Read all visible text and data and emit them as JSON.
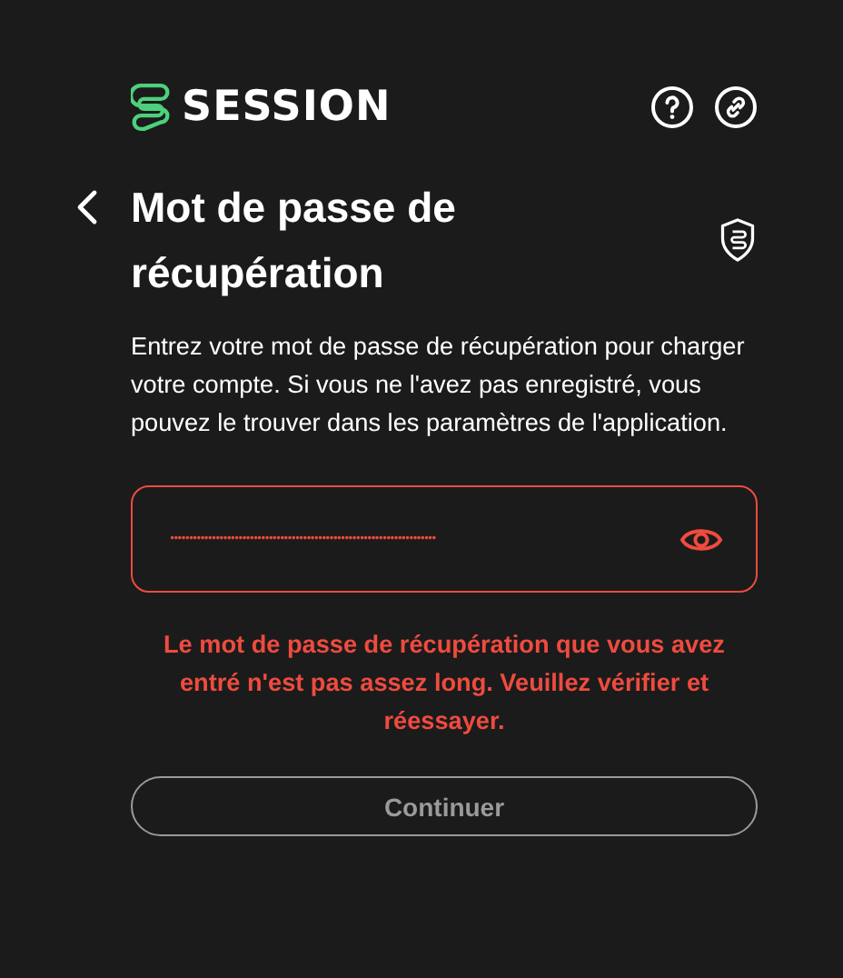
{
  "header": {
    "logo_text": "SESSION"
  },
  "title": "Mot de passe de récupération",
  "description": "Entrez votre mot de passe de récupération pour charger votre compte. Si vous ne l'avez pas enregistré, vous pouvez le trouver dans les paramètres de l'application.",
  "password_field": {
    "value": "••••••••••••••••••••••••••••••••••••••••••••••••••••••••••••••••••••••",
    "error": true
  },
  "error_message": "Le mot de passe de récupération que vous avez entré n'est pas assez long. Veuillez vérifier et réessayer.",
  "continue_button": {
    "label": "Continuer",
    "disabled": true
  }
}
